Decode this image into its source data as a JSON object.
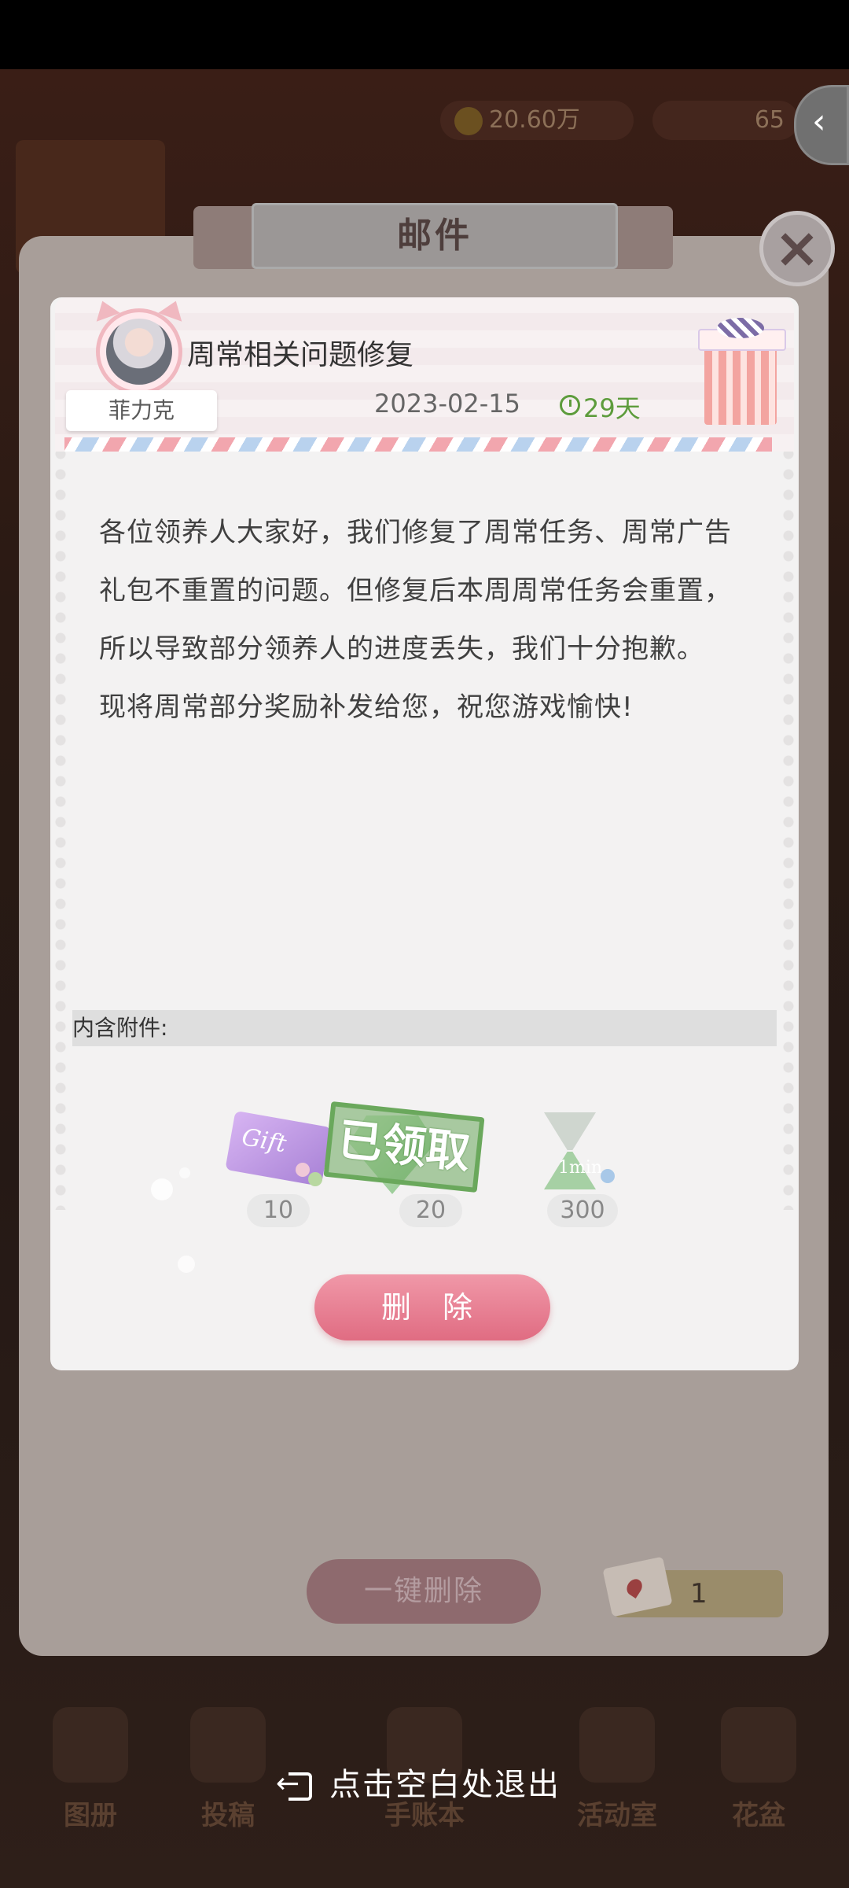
{
  "mail_window": {
    "title": "邮件",
    "close_icon": "close-icon"
  },
  "top_bar": {
    "coins": "20.60万",
    "gems": "65"
  },
  "mail": {
    "sender": "菲力克",
    "subject": "周常相关问题修复",
    "date": "2023-02-15",
    "expires_in": "29天",
    "body_lines": [
      "各位领养人大家好，我们修复了周常任务、周常广告礼包不重置的问题。但修复后本周周常任务会重置，所以导致部分领养人的进度丢失，我们十分抱歉。",
      "现将周常部分奖励补发给您，祝您游戏愉快!"
    ],
    "attachments_label": "内含附件:",
    "attachments": [
      {
        "icon": "gift-ticket-icon",
        "text": "Gift",
        "count": "10"
      },
      {
        "icon": "green-diamond-icon",
        "count": "20"
      },
      {
        "icon": "hourglass-icon",
        "text": "1min",
        "count": "300"
      }
    ],
    "claimed_stamp": "已领取",
    "delete_label": "删 除"
  },
  "board": {
    "batch_delete_label": "一键删除",
    "mail_count": "1"
  },
  "bottom_nav": [
    "图册",
    "投稿",
    "手账本",
    "活动室",
    "花盆"
  ],
  "exit_hint": "点击空白处退出",
  "colors": {
    "accent_pink": "#e06c82",
    "expiry_green": "#5d9c3c",
    "stamp_green": "#6aa85c"
  }
}
